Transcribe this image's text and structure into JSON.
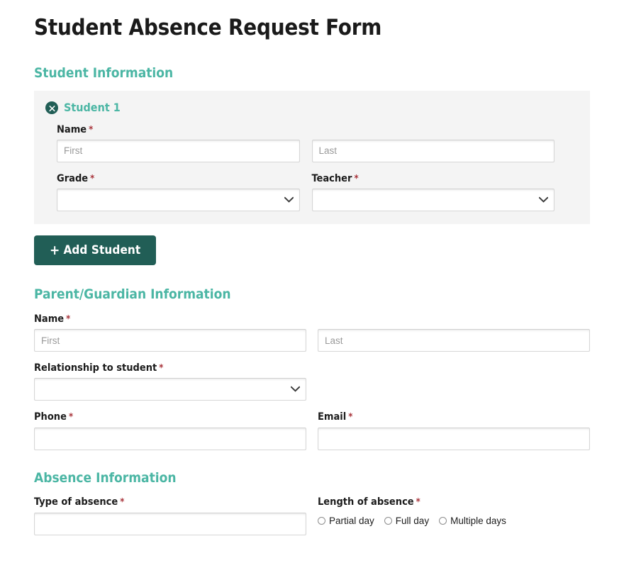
{
  "form": {
    "title": "Student Absence Request Form"
  },
  "student_section": {
    "heading": "Student Information",
    "panel": {
      "remove_icon": "remove-circle-x-icon",
      "title": "Student 1",
      "name_label": "Name",
      "required_mark": "*",
      "first_placeholder": "First",
      "last_placeholder": "Last",
      "first_value": "",
      "last_value": "",
      "grade_label": "Grade",
      "grade_value": "",
      "teacher_label": "Teacher",
      "teacher_value": "",
      "chevron_icon": "chevron-down-icon"
    },
    "add_button": {
      "plus_icon": "plus-icon",
      "label": "Add Student"
    }
  },
  "parent_section": {
    "heading": "Parent/Guardian Information",
    "name_label": "Name",
    "required_mark": "*",
    "first_placeholder": "First",
    "last_placeholder": "Last",
    "first_value": "",
    "last_value": "",
    "relationship_label": "Relationship to student",
    "relationship_value": "",
    "phone_label": "Phone",
    "phone_value": "",
    "email_label": "Email",
    "email_value": "",
    "chevron_icon": "chevron-down-icon"
  },
  "absence_section": {
    "heading": "Absence Information",
    "type_label": "Type of absence",
    "type_value": "",
    "required_mark": "*",
    "length_label": "Length of absence",
    "length_options": [
      {
        "label": "Partial day",
        "selected": false
      },
      {
        "label": "Full day",
        "selected": false
      },
      {
        "label": "Multiple days",
        "selected": false
      }
    ]
  },
  "colors": {
    "heading_teal": "#4bb6a4",
    "button_teal": "#215e56",
    "required_red": "#a8333a",
    "panel_bg": "#f4f4f4"
  }
}
